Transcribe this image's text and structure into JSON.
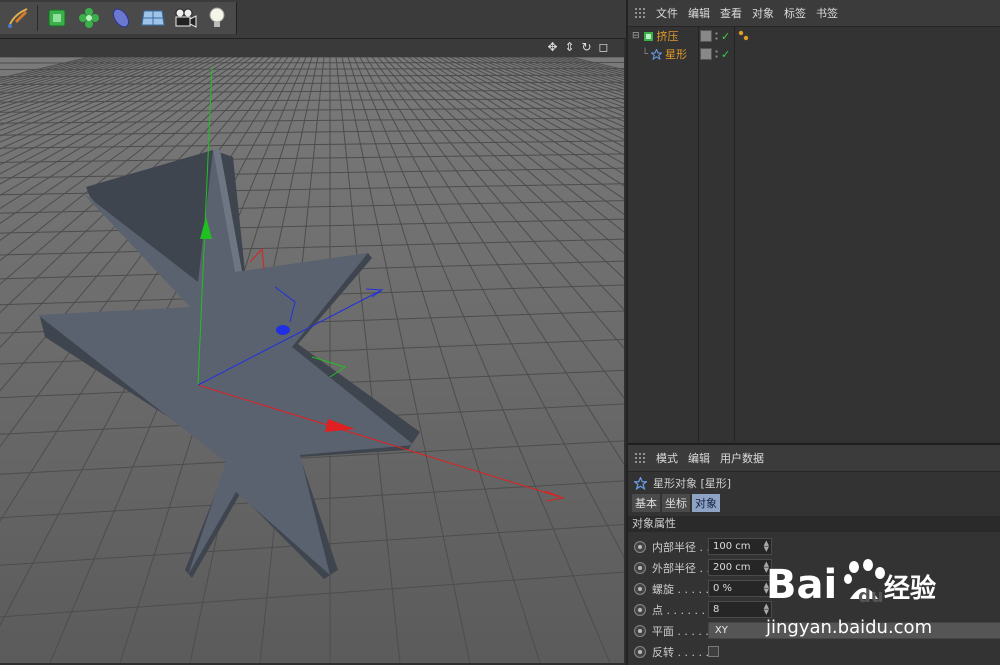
{
  "toolbar": {
    "tools": [
      {
        "icon": "pen-spline-icon"
      },
      {
        "icon": "cube-generator-icon"
      },
      {
        "icon": "cloner-flower-icon"
      },
      {
        "icon": "deformer-icon"
      },
      {
        "icon": "floor-plane-icon"
      },
      {
        "icon": "camera-icon"
      },
      {
        "icon": "light-bulb-icon"
      }
    ]
  },
  "viewport": {
    "nav_icons": [
      "move-view-icon",
      "dolly-view-icon",
      "rotate-view-icon",
      "maximize-view-icon"
    ]
  },
  "object_manager": {
    "menu": [
      "文件",
      "编辑",
      "查看",
      "对象",
      "标签",
      "书签"
    ],
    "tree": [
      {
        "label": "挤压",
        "icon": "extrude-icon",
        "selected_color": "#e39b2a"
      },
      {
        "label": "星形",
        "icon": "star-spline-icon",
        "selected_color": "#e39b2a"
      }
    ]
  },
  "attributes": {
    "menu": [
      "模式",
      "编辑",
      "用户数据"
    ],
    "title": "星形对象 [星形]",
    "tabs": [
      "基本",
      "坐标",
      "对象"
    ],
    "active_tab": "对象",
    "section": "对象属性",
    "props": [
      {
        "label": "内部半径 . .",
        "value": "100 cm"
      },
      {
        "label": "外部半径 . .",
        "value": "200 cm"
      },
      {
        "label": "螺旋 . . . . .",
        "value": "0 %"
      },
      {
        "label": "点 . . . . . . .",
        "value": "8"
      },
      {
        "label": "平面 . . . . .",
        "value": "XY"
      },
      {
        "label": "反转 . . . . .",
        "value": ""
      }
    ]
  },
  "watermark": {
    "brand": "Bai",
    "brand2": "du",
    "cn": "经验",
    "url": "jingyan.baidu.com"
  },
  "colors": {
    "axis_x": "#e02020",
    "axis_y": "#20c020",
    "axis_z": "#2030e0",
    "star_fill": "#5a6270"
  }
}
